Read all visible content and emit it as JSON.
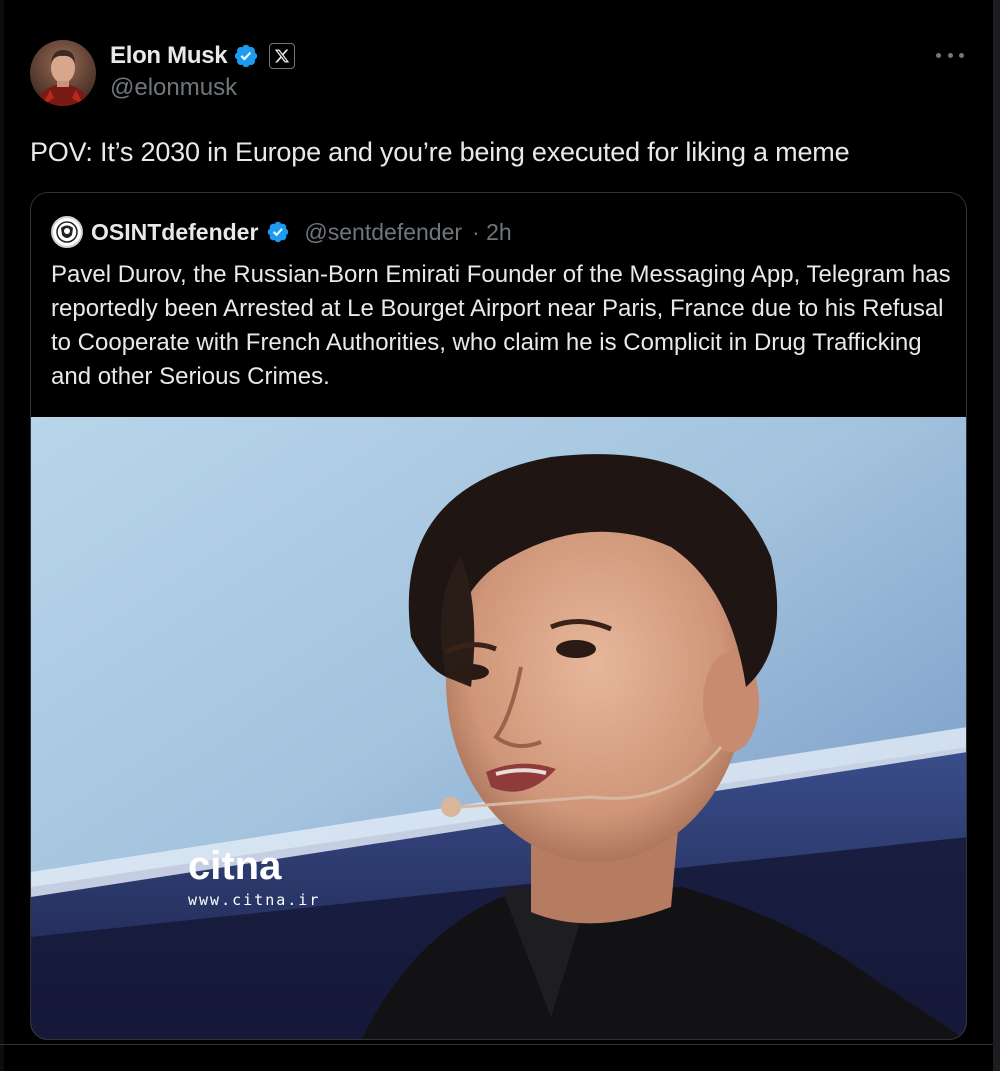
{
  "tweet": {
    "author": {
      "display_name": "Elon Musk",
      "handle": "@elonmusk",
      "verified_icon": "verified-badge-icon",
      "affiliate_icon": "x-logo-icon"
    },
    "more_icon": "more-options-icon",
    "text": "POV: It’s 2030 in Europe and you’re being executed for liking a meme",
    "quoted": {
      "display_name": "OSINTdefender",
      "handle": "@sentdefender",
      "time": "· 2h",
      "verified_icon": "verified-badge-icon",
      "text": "Pavel Durov, the Russian-Born Emirati Founder of the Messaging App, Telegram has reportedly been Arrested at Le Bourget Airport near Paris, France due to his Refusal to Cooperate with French Authorities, who claim he is Complicit in Drug Trafficking and other Serious Crimes.",
      "media": {
        "watermark_logo": "citna",
        "watermark_url": "www.citna.ir"
      }
    }
  },
  "colors": {
    "background": "#000000",
    "text_primary": "#e7e9ea",
    "text_secondary": "#71767b",
    "verified_blue": "#1d9bf0",
    "border": "#2f3336"
  }
}
